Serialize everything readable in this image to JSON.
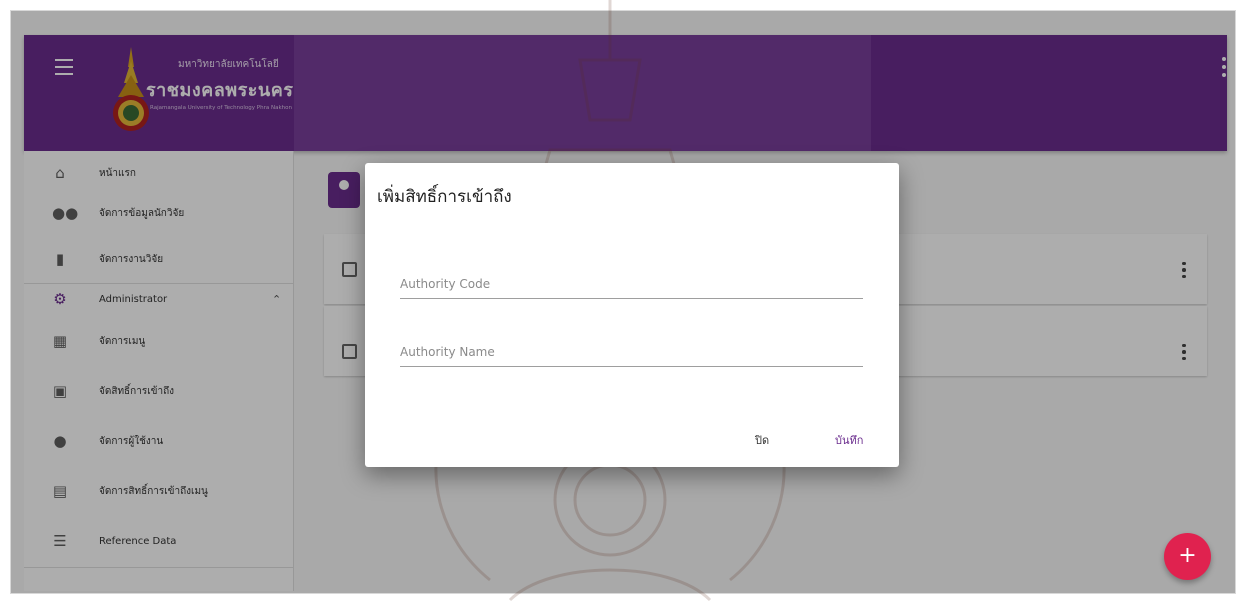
{
  "header": {
    "university_small": "มหาวิทยาลัยเทคโนโลยี",
    "university_big": "ราชมงคลพระนคร",
    "university_en": "Rajamangala University of Technology Phra Nakhon",
    "brand_color": "#6b2d8e"
  },
  "sidebar": {
    "items": [
      {
        "label": "หน้าแรก",
        "icon": "home-icon"
      },
      {
        "label": "จัดการข้อมูลนักวิจัย",
        "icon": "people-icon"
      },
      {
        "label": "จัดการงานวิจัย",
        "icon": "document-icon"
      },
      {
        "label": "Administrator",
        "icon": "gear-icon",
        "expanded": true
      },
      {
        "label": "จัดการเมนู",
        "icon": "dashboard-icon"
      },
      {
        "label": "จัดสิทธิ์การเข้าถึง",
        "icon": "badge-icon"
      },
      {
        "label": "จัดการผู้ใช้งาน",
        "icon": "person-icon"
      },
      {
        "label": "จัดการสิทธิ์การเข้าถึงเมนู",
        "icon": "clipboard-icon"
      },
      {
        "label": "Reference Data",
        "icon": "list-icon"
      }
    ]
  },
  "dialog": {
    "title": "เพิ่มสิทธิ์การเข้าถึง",
    "authority_code_placeholder": "Authority Code",
    "authority_name_placeholder": "Authority Name",
    "close_label": "ปิด",
    "save_label": "บันทึก"
  },
  "fab": {
    "label": "+",
    "color": "#e0224f"
  }
}
